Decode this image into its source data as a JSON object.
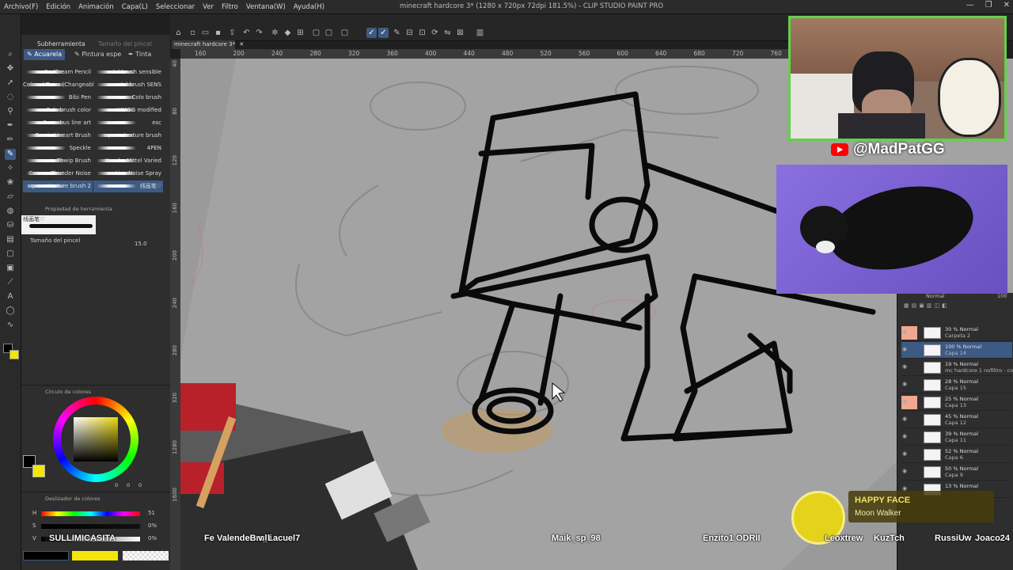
{
  "window": {
    "title": "minecraft hardcore 3* (1280 x 720px 72dpi 181.5%) - CLIP STUDIO PAINT PRO",
    "canvas_tab": "minecraft hardcore 3*"
  },
  "menu": [
    "Archivo(F)",
    "Edición",
    "Animación",
    "Capa(L)",
    "Seleccionar",
    "Ver",
    "Filtro",
    "Ventana(W)",
    "Ayuda(H)"
  ],
  "panel_tabs": [
    "Subherramienta",
    "Tamaño del pincel"
  ],
  "subtool_tabs": [
    "Acuarela",
    "Pintura espe",
    "Tinta"
  ],
  "brushes_left": [
    "SudCream Pencil",
    "Colored Trees (Changeabl",
    "Bibi Pen",
    "Colo brush color",
    "Succubus line art",
    "Comic Lineart Brush",
    "Speckle",
    "Thwip Brush",
    "Canvas Thunder Noise",
    "square texture brush 2"
  ],
  "brushes_right": [
    "lal brush sensible",
    "lal brush SENS",
    "Colo brush",
    "HIMGG modified",
    "esc",
    "square texture brush",
    "4PEN",
    "Kazuke Mittel Varied",
    "Line Noise Spray",
    "线画笔♡"
  ],
  "tool_property": {
    "title": "Propiedad de herramienta",
    "brush_name": "线画笔♡",
    "size_label": "Tamaño del pincel",
    "size_value": "15.0"
  },
  "color_wheel": {
    "title": "Círculo de colores",
    "values": [
      "0",
      "0",
      "0"
    ]
  },
  "color_sliders": {
    "title": "Deslizador de colores",
    "labels": [
      "H",
      "S",
      "V"
    ],
    "values": [
      "51",
      "0%",
      "0%"
    ]
  },
  "ruler_top": [
    "160",
    "200",
    "240",
    "280",
    "320",
    "360",
    "400",
    "440",
    "480",
    "520",
    "560",
    "600",
    "640",
    "680",
    "720",
    "760"
  ],
  "ruler_left": [
    "40",
    "80",
    "120",
    "160",
    "200",
    "240",
    "280",
    "320",
    "1280",
    "1600"
  ],
  "layers": [
    {
      "line1": "30 % Normal",
      "line2": "Carpeta 2",
      "vis": true
    },
    {
      "line1": "100 % Normal",
      "line2": "Capa 14",
      "selected": true
    },
    {
      "line1": "19 % Normal",
      "line2": "mc hardcore 1 nofiltro - copia"
    },
    {
      "line1": "28 % Normal",
      "line2": "Capa 15"
    },
    {
      "line1": "25 % Normal",
      "line2": "Capa 13",
      "vis": true
    },
    {
      "line1": "45 % Normal",
      "line2": "Capa 12"
    },
    {
      "line1": "39 % Normal",
      "line2": "Capa 11"
    },
    {
      "line1": "52 % Normal",
      "line2": "Capa 6"
    },
    {
      "line1": "50 % Normal",
      "line2": "Capa 9"
    },
    {
      "line1": "13 % Normal",
      "line2": ""
    }
  ],
  "layer_blend": "Normal",
  "layer_opacity": "100",
  "stream": {
    "handle": "@MadPatGG",
    "chat_names": [
      "Fe",
      "ValendeBrulli",
      "v_Lacuel7",
      "SULLIMICASITA",
      "Maik_sp_98",
      "Enzito1",
      "ODRII",
      "Leoxtrew",
      "KuzTch",
      "RussiUw",
      "Joaco24"
    ],
    "now_playing": {
      "song": "HAPPY FACE",
      "artist": "Moon Walker"
    }
  },
  "colors": {
    "accent": "#3d5a84",
    "webcam_border": "#62d14a",
    "youtube": "#ff0000",
    "primary": "#000000",
    "secondary": "#f5e60a"
  }
}
